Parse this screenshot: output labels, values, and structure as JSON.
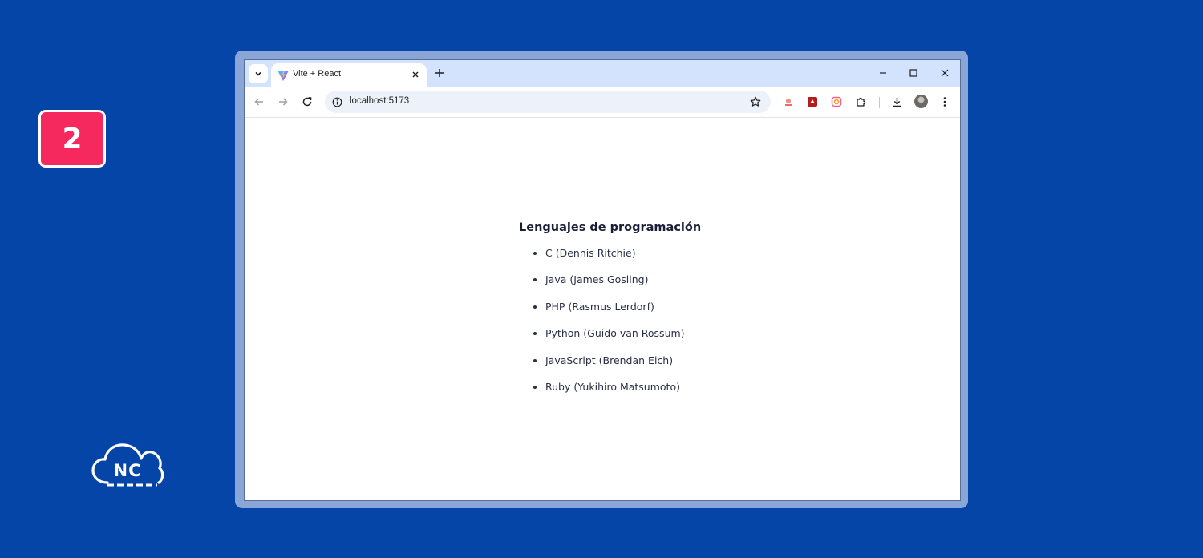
{
  "step_badge": {
    "number": "2",
    "color": "#f5295e"
  },
  "logo": {
    "text": "NC",
    "icon": "cloud-icon"
  },
  "browser": {
    "tab": {
      "title": "Vite + React",
      "favicon": "vite-favicon"
    },
    "toolbar": {
      "url": "localhost:5173",
      "icons": [
        "back-arrow-icon",
        "forward-arrow-icon",
        "reload-icon",
        "info-icon",
        "bookmark-star-icon",
        "extension-icons",
        "puzzle-icon",
        "download-icon",
        "avatar",
        "menu-kebab-icon"
      ]
    }
  },
  "page": {
    "title": "Lenguajes de programación",
    "languages": [
      "C (Dennis Ritchie)",
      "Java (James Gosling)",
      "PHP (Rasmus Lerdorf)",
      "Python (Guido van Rossum)",
      "JavaScript (Brendan Eich)",
      "Ruby (Yukihiro Matsumoto)"
    ]
  },
  "colors": {
    "background": "#0645a8",
    "frame": "#8aa6d9",
    "tabstrip": "#d3e3fd",
    "omnibox": "#edf2fa",
    "text": "#1a1f36"
  }
}
